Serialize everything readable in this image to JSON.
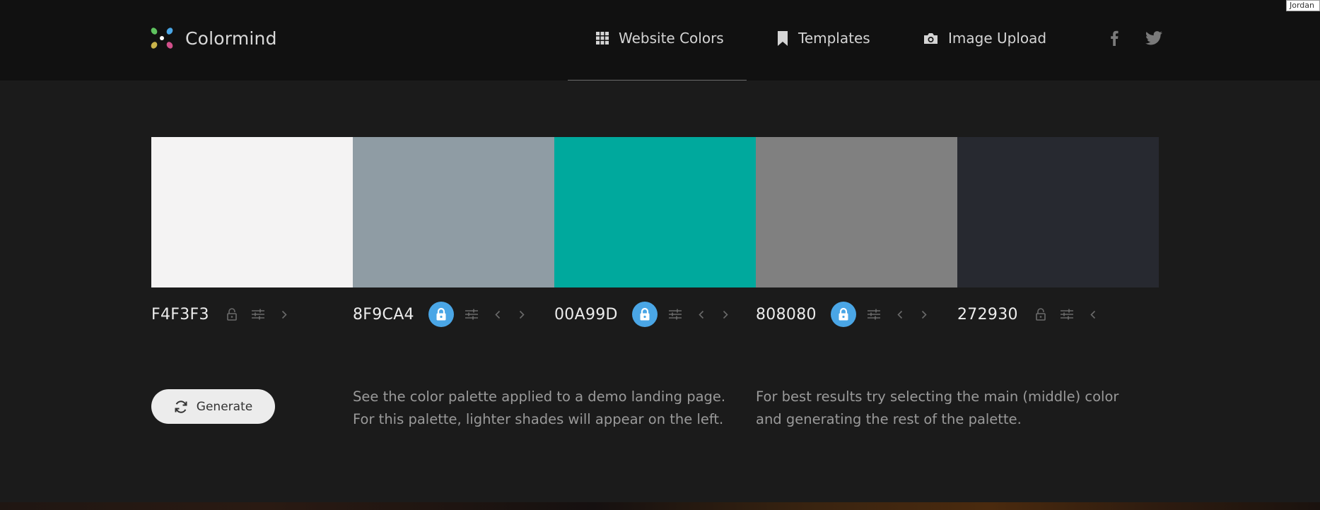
{
  "app": {
    "name": "Colormind",
    "logo_colors": [
      "#5fc35f",
      "#4aa6e6",
      "#c9b34a",
      "#d14f8a",
      "#ffffff"
    ]
  },
  "nav": {
    "items": [
      {
        "label": "Website Colors",
        "icon": "grid-icon",
        "active": true
      },
      {
        "label": "Templates",
        "icon": "bookmark-icon",
        "active": false
      },
      {
        "label": "Image Upload",
        "icon": "camera-icon",
        "active": false
      }
    ],
    "social": [
      {
        "icon": "facebook-icon"
      },
      {
        "icon": "twitter-icon"
      }
    ]
  },
  "corner_label": "Jordan",
  "palette": [
    {
      "hex": "F4F3F3",
      "color": "#f4f3f3",
      "locked": false,
      "adjust_icon": "sliders-icon",
      "arrows": [
        "right"
      ]
    },
    {
      "hex": "8F9CA4",
      "color": "#8f9ca4",
      "locked": true,
      "adjust_icon": "sliders-icon",
      "arrows": [
        "left",
        "right"
      ]
    },
    {
      "hex": "00A99D",
      "color": "#00a99d",
      "locked": true,
      "adjust_icon": "sliders-icon",
      "arrows": [
        "left",
        "right"
      ]
    },
    {
      "hex": "808080",
      "color": "#808080",
      "locked": true,
      "adjust_icon": "sliders-icon",
      "arrows": [
        "left",
        "right"
      ]
    },
    {
      "hex": "272930",
      "color": "#272930",
      "locked": false,
      "adjust_icon": "sliders-icon",
      "arrows": [
        "left"
      ]
    }
  ],
  "generate_button": {
    "label": "Generate",
    "icon": "refresh-icon"
  },
  "info": {
    "demo_text_1": "See the color palette applied to a demo landing page.",
    "demo_text_2": "For this palette, lighter shades will appear on the left.",
    "tip_text_1": "For best results try selecting the main (middle) color",
    "tip_text_2": "and generating the rest of the palette."
  },
  "colors": {
    "header_bg": "#111111",
    "page_bg": "#1b1b1b",
    "lock_active": "#4aa6e6",
    "button_bg": "#ececec"
  }
}
